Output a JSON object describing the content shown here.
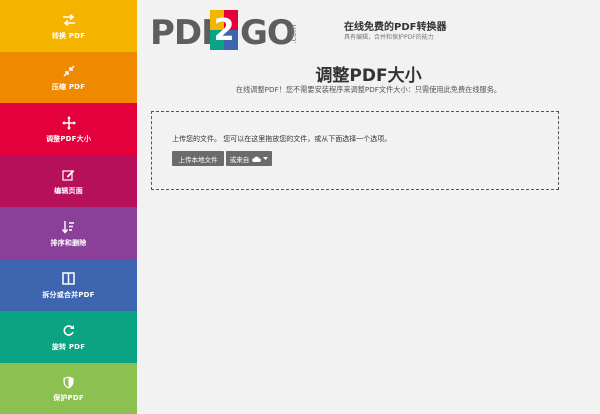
{
  "sidebar": {
    "items": [
      {
        "label": "转换 PDF",
        "icon": "exchange-arrows-icon",
        "color": "#f4b400"
      },
      {
        "label": "压缩 PDF",
        "icon": "compress-arrows-icon",
        "color": "#ef8a00"
      },
      {
        "label": "调整PDF大小",
        "icon": "move-arrows-icon",
        "color": "#e3003b"
      },
      {
        "label": "编辑页面",
        "icon": "edit-pencil-icon",
        "color": "#b7105a"
      },
      {
        "label": "排序和删除",
        "icon": "sort-icon",
        "color": "#8a3f99"
      },
      {
        "label": "拆分或合并PDF",
        "icon": "columns-icon",
        "color": "#3e66b0"
      },
      {
        "label": "旋转 PDF",
        "icon": "rotate-icon",
        "color": "#0aa383"
      },
      {
        "label": "保护PDF",
        "icon": "shield-icon",
        "color": "#8cc152"
      }
    ]
  },
  "header": {
    "logo": {
      "pdf": "PDF",
      "two": "2",
      "go": "GO",
      "com": ".com"
    },
    "tagline_title": "在线免费的PDF转换器",
    "tagline_sub": "具有编辑，合并和保护PDF的能力"
  },
  "main": {
    "title": "调整PDF大小",
    "subtitle": "在线调整PDF！您不需要安装程序来调整PDF文件大小：只需使用此免费在线服务。",
    "dropzone_text": "上传您的文件。 您可以在这里拖放您的文件，或从下面选择一个选项。",
    "upload_button": "上传本地文件",
    "from_button": "或来自"
  }
}
